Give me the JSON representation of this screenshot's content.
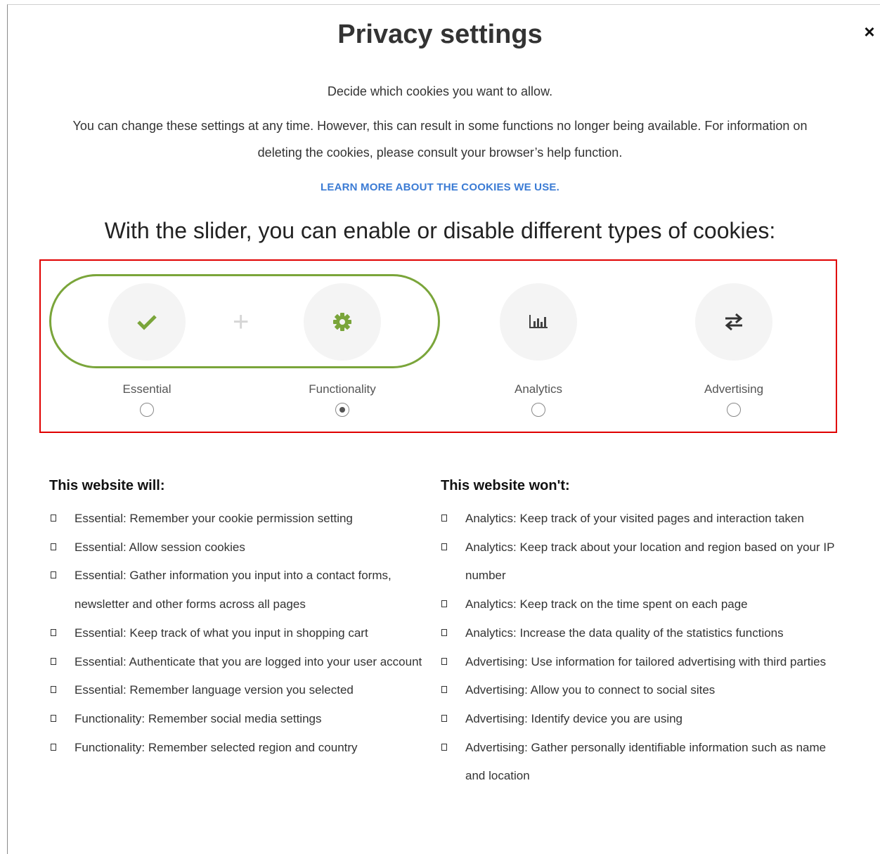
{
  "dialog": {
    "title": "Privacy settings",
    "close_label": "×",
    "intro_line1": "Decide which cookies you want to allow.",
    "intro_line2": "You can change these settings at any time. However, this can result in some functions no longer being available. For information on deleting the cookies, please consult your browser’s help function.",
    "learn_more": "LEARN MORE ABOUT THE COOKIES WE USE.",
    "slider_heading": "With the slider, you can enable or disable different types of cookies:"
  },
  "categories": [
    {
      "label": "Essential",
      "icon": "check-icon",
      "selected": false
    },
    {
      "label": "Functionality",
      "icon": "gear-icon",
      "selected": true
    },
    {
      "label": "Analytics",
      "icon": "bar-chart-icon",
      "selected": false
    },
    {
      "label": "Advertising",
      "icon": "arrows-exchange-icon",
      "selected": false
    }
  ],
  "colors": {
    "accent_green": "#7aa53a",
    "highlight_red": "#e00000",
    "link_blue": "#3b7bd4",
    "will_bullet": "#7cc46a",
    "wont_bullet": "#f2b080"
  },
  "will": {
    "title": "This website will:",
    "items": [
      "Essential: Remember your cookie permission setting",
      "Essential: Allow session cookies",
      "Essential: Gather information you input into a contact forms, newsletter and other forms across all pages",
      "Essential: Keep track of what you input in shopping cart",
      "Essential: Authenticate that you are logged into your user account",
      "Essential: Remember language version you selected",
      "Functionality: Remember social media settings",
      "Functionality: Remember selected region and country"
    ]
  },
  "wont": {
    "title": "This website won't:",
    "items": [
      "Analytics: Keep track of your visited pages and interaction taken",
      "Analytics: Keep track about your location and region based on your IP number",
      "Analytics: Keep track on the time spent on each page",
      "Analytics: Increase the data quality of the statistics functions",
      "Advertising: Use information for tailored advertising with third parties",
      "Advertising: Allow you to connect to social sites",
      "Advertising: Identify device you are using",
      "Advertising: Gather personally identifiable information such as name and location"
    ]
  }
}
